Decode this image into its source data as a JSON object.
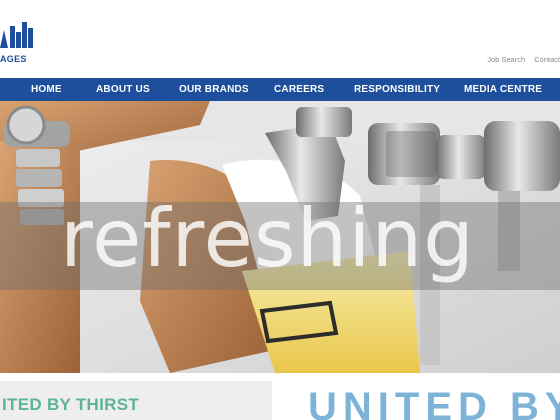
{
  "header": {
    "logo_text": "AGES",
    "utility_links": [
      "Job Search",
      "Contact"
    ]
  },
  "nav": {
    "items": [
      "HOME",
      "ABOUT US",
      "OUR BRANDS",
      "CAREERS",
      "RESPONSIBILITY",
      "MEDIA CENTRE"
    ]
  },
  "hero": {
    "word": "refreshing"
  },
  "bottom": {
    "tagline": "ITED BY THIRST",
    "banner_text": "UNITED BY"
  },
  "colors": {
    "brand_blue": "#1d4f9c",
    "tagline_green": "#5bb49a",
    "banner_blue": "#7db3d6"
  }
}
